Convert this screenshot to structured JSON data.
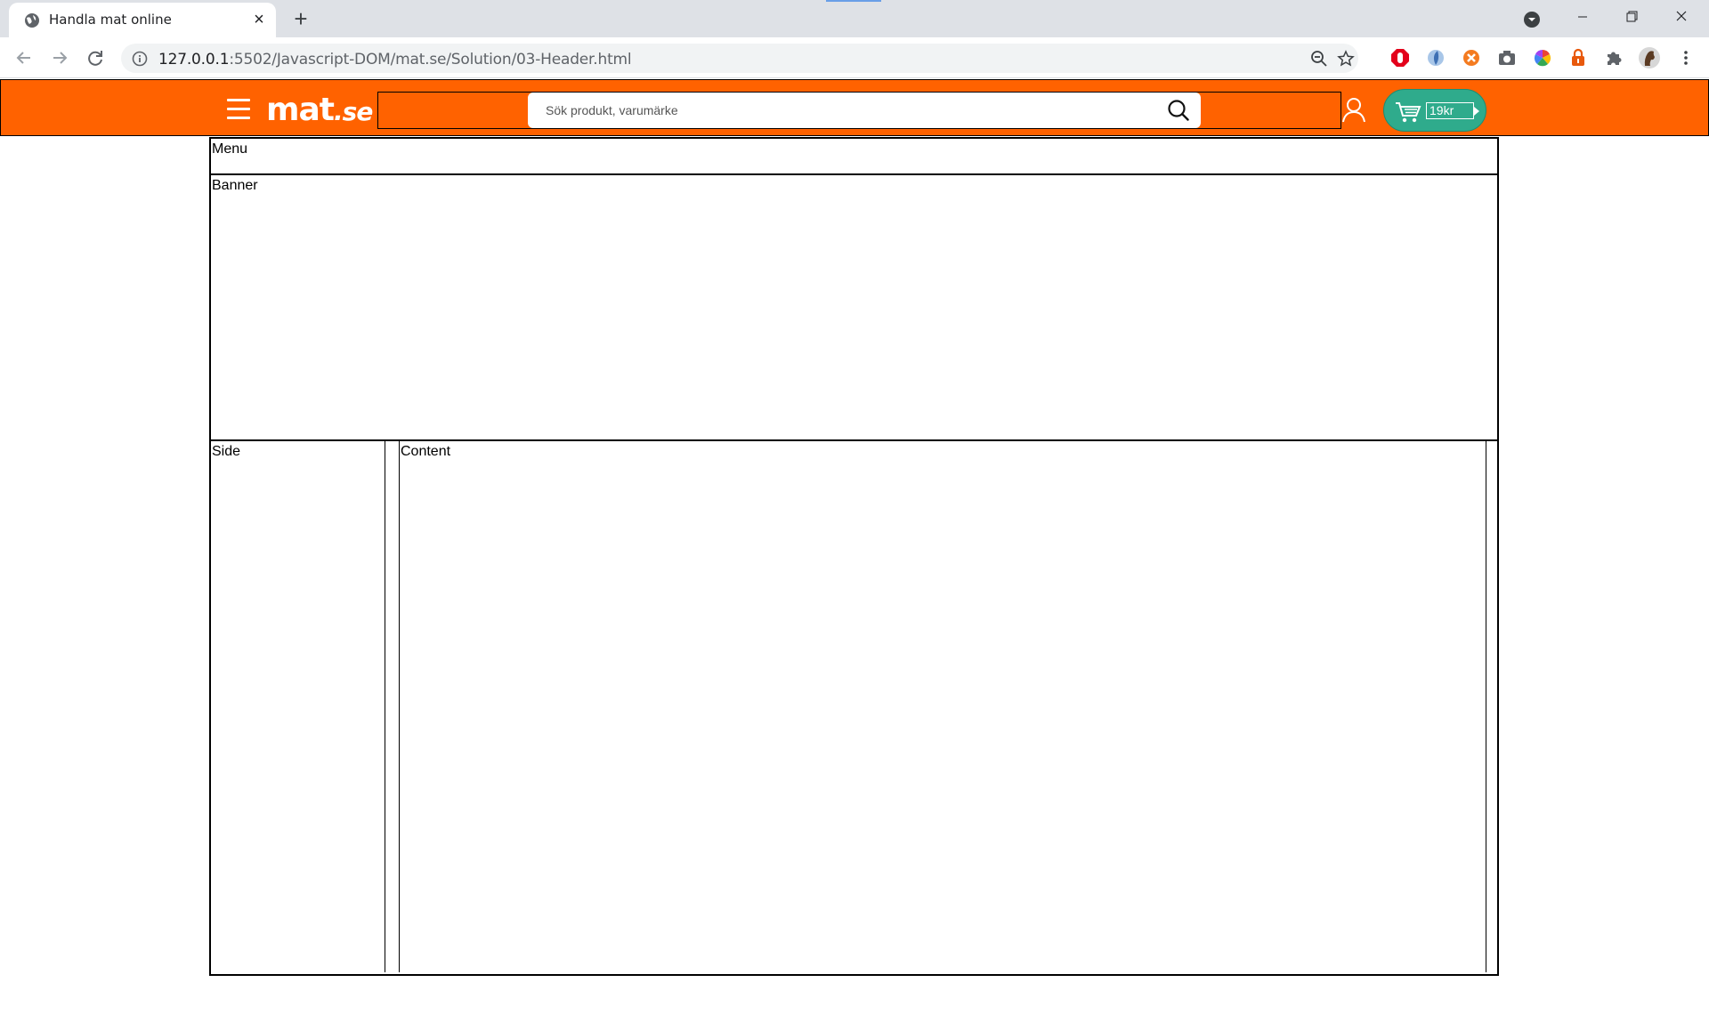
{
  "browser": {
    "tab": {
      "title": "Handla mat online"
    },
    "new_tab_label": "+",
    "url": {
      "host": "127.0.0.1",
      "path": ":5502/Javascript-DOM/mat.se/Solution/03-Header.html"
    }
  },
  "header": {
    "logo_main": "mat",
    "logo_tld": ".se",
    "search": {
      "placeholder": "Sök produkt, varumärke",
      "value": ""
    },
    "cart": {
      "total": "19kr"
    },
    "colors": {
      "header_bg": "#ff6200",
      "cart_bg": "#2fab8c"
    }
  },
  "sections": {
    "menu": "Menu",
    "banner": "Banner",
    "side": "Side",
    "content": "Content"
  }
}
